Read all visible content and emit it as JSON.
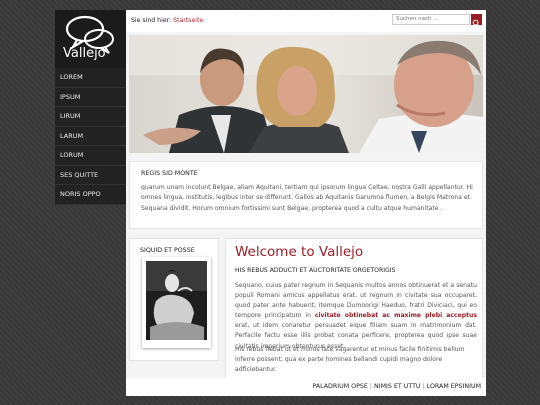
{
  "brand": {
    "name": "Vallejo"
  },
  "nav": {
    "items": [
      "LOREM",
      "IPSUM",
      "LIRUM",
      "LARUM",
      "LORUM",
      "SES QUITTE",
      "NORIS OPPO"
    ]
  },
  "breadcrumb": {
    "prefix": "Sie sind hier:",
    "current": "Startseite"
  },
  "search": {
    "placeholder": "Suchen nach ..."
  },
  "intro": {
    "title": "REGIS SID MONTE",
    "text": "quarum unam incolunt Belgae, aliam Aquitani, tertiam qui ipsorum lingua Celtae, nostra Galli appellantur. Hi omnes lingua, institutis, legibus inter se differunt. Gallos ab Aquitanis Garumna flumen, a Belgis Matrona et Sequana dividit. Horum omnium fortissimi sunt Belgae, propterea quod a cultu atque humanitate ."
  },
  "sidebar": {
    "title": "SIQUID ET POSSE"
  },
  "main": {
    "title": "Welcome to Vallejo",
    "subtitle": "HIS REBUS ADDUCTI ET AUCTORITATE ORGETORIGIS",
    "p1_before": "Sequano, cuius pater regnum in Sequanis multos annos obtinuerat et a senatu populi Romani amicus appellatus erat, ut regnum in civitate sua occuparet, quod pater ante habuerit; itemque Dumnorigi Haeduo, fratri Diviciaci, qui eo tempore principatum in ",
    "p1_highlight": "civitate obtinebat ac maxime plebi acceptus",
    "p1_after": " erat, ut idem conaretur persuadet eique filiam suam in matrimonium dat. Perfacile factu esse illis probat conata perficere, propterea quod ipse suae civitatis imperium obtenturus esset.",
    "p2": "His rebus fiebat ut et minus late vagarentur et minus facile finitimis bellum inferre possent; qua ex parte homines bellandi cupidi magno dolore adficiebantur."
  },
  "footer": {
    "links": [
      "PALADRIUM OPSE",
      "NIMIS ET UTTU",
      "LORAM EPSINIUM"
    ]
  },
  "colors": {
    "accent": "#9b1c24",
    "nav_bg": "#222222",
    "logo_bg": "#1b1b1b",
    "page_bg": "#f4f4f4"
  },
  "icons": {
    "logo": "speech-bubbles-icon",
    "search_button": "search-icon"
  }
}
